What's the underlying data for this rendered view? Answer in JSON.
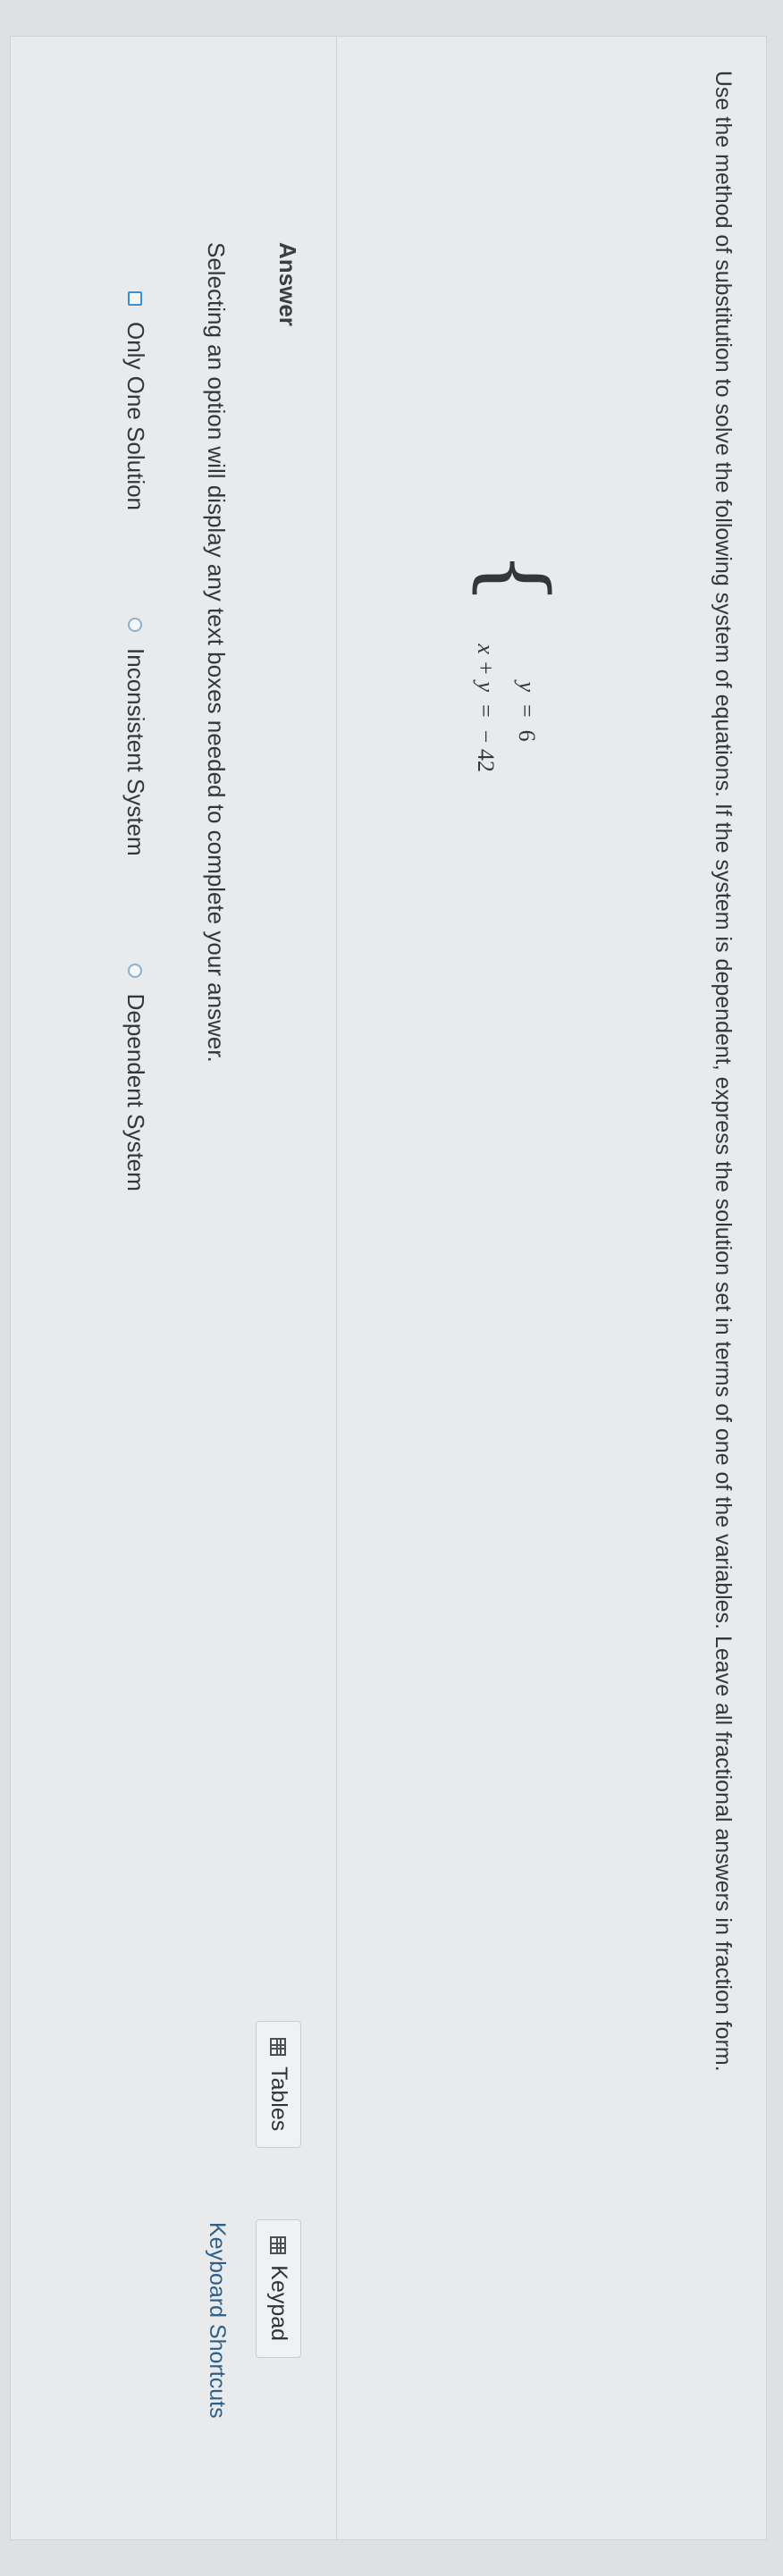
{
  "question": {
    "text": "Use the method of substitution to solve the following system of equations. If the system is dependent, express the solution set in terms of one of the variables. Leave all fractional answers in fraction form."
  },
  "system": {
    "eq1": {
      "lhs": "y",
      "op": "=",
      "rhs": "6"
    },
    "eq2": {
      "lhs": "x + y",
      "op": "=",
      "rhs": "− 42"
    }
  },
  "answer": {
    "label": "Answer",
    "instructions": "Selecting an option will display any text boxes needed to complete your answer.",
    "options": [
      {
        "label": "Only One Solution"
      },
      {
        "label": "Inconsistent System"
      },
      {
        "label": "Dependent System"
      }
    ]
  },
  "toolbar": {
    "tables_label": "Tables",
    "keypad_label": "Keypad",
    "shortcuts_label": "Keyboard Shortcuts"
  }
}
